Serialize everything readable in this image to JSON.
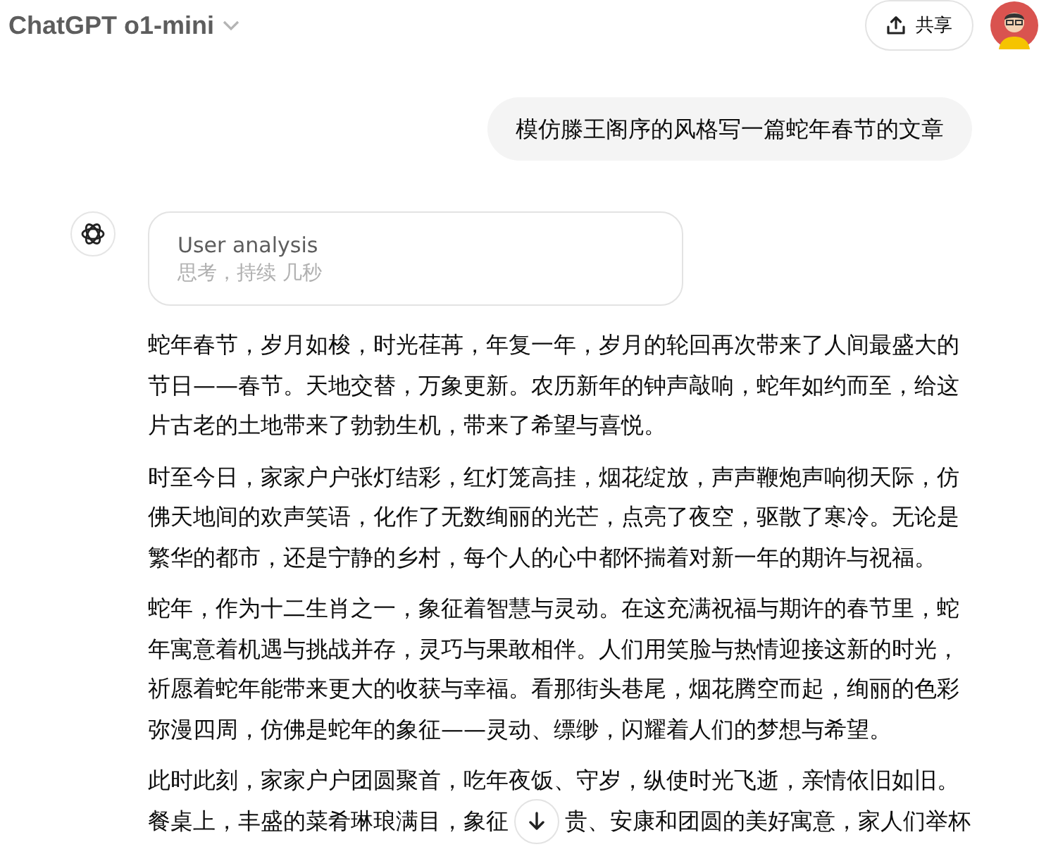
{
  "header": {
    "title": "ChatGPT o1-mini",
    "share_button": "共享"
  },
  "user_message": "模仿滕王阁序的风格写一篇蛇年春节的文章",
  "reasoning": {
    "title": "User analysis",
    "subtitle": "思考，持续 几秒"
  },
  "answer_paragraphs": [
    "蛇年春节，岁月如梭，时光荏苒，年复一年，岁月的轮回再次带来了人间最盛大的节日——春节。天地交替，万象更新。农历新年的钟声敲响，蛇年如约而至，给这片古老的土地带来了勃勃生机，带来了希望与喜悦。",
    "时至今日，家家户户张灯结彩，红灯笼高挂，烟花绽放，声声鞭炮声响彻天际，仿佛天地间的欢声笑语，化作了无数绚丽的光芒，点亮了夜空，驱散了寒冷。无论是繁华的都市，还是宁静的乡村，每个人的心中都怀揣着对新一年的期许与祝福。",
    "蛇年，作为十二生肖之一，象征着智慧与灵动。在这充满祝福与期许的春节里，蛇年寓意着机遇与挑战并存，灵巧与果敢相伴。人们用笑脸与热情迎接这新的时光，祈愿着蛇年能带来更大的收获与幸福。看那街头巷尾，烟花腾空而起，绚丽的色彩弥漫四周，仿佛是蛇年的象征——灵动、缥缈，闪耀着人们的梦想与希望。"
  ],
  "last_paragraph": {
    "line_1": "此时此刻，家家户户团圆聚首，吃年夜饭、守岁，纵使时光飞逝，亲情依旧如旧。",
    "line_2_before": "餐桌上，丰盛的菜肴琳琅满目，象征",
    "line_2_after": "贵、安康和团圆的美好寓意，家人们举杯"
  }
}
